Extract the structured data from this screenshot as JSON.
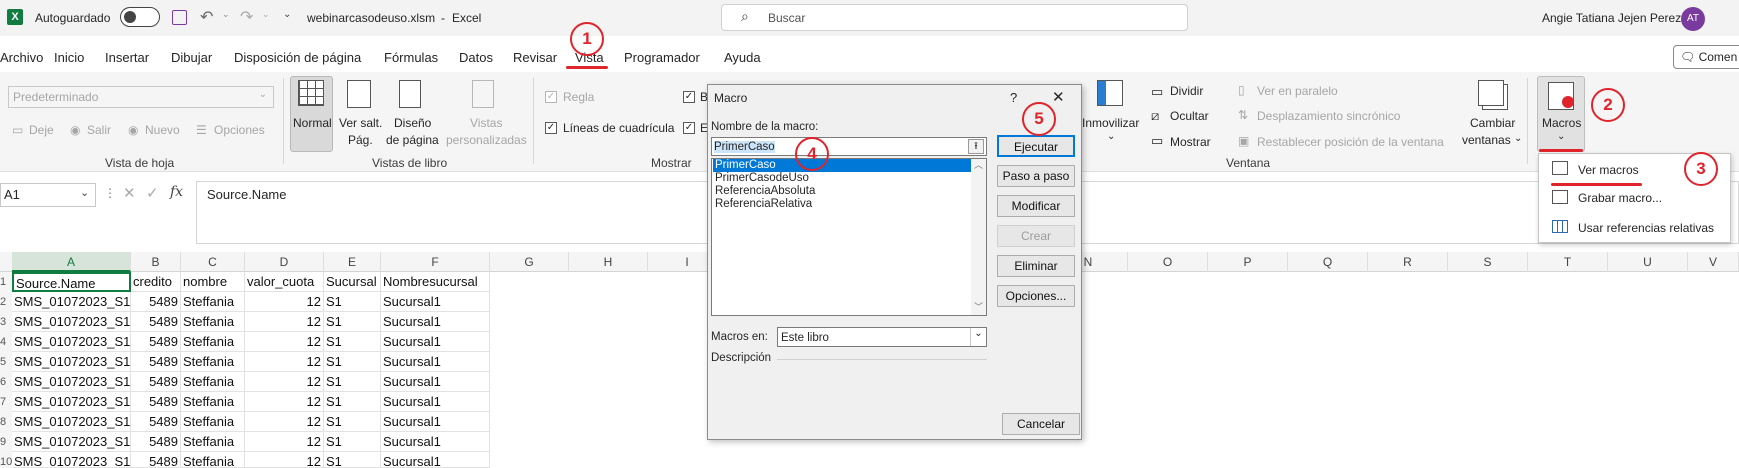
{
  "titlebar": {
    "autosave_label": "Autoguardado",
    "filename": "webinarcasodeuso.xlsm",
    "separator": "-",
    "app": "Excel",
    "search_placeholder": "Buscar",
    "user": "Angie Tatiana Jejen Perez",
    "avatar_initials": "AT"
  },
  "tabs": [
    "Archivo",
    "Inicio",
    "Insertar",
    "Dibujar",
    "Disposición de página",
    "Fórmulas",
    "Datos",
    "Revisar",
    "Vista",
    "Programador",
    "Ayuda"
  ],
  "comment_label": "Comen",
  "ribbon": {
    "sheet_views": {
      "select_value": "Predeterminado",
      "keep": "Deje",
      "exit": "Salir",
      "new": "Nuevo",
      "options": "Opciones",
      "label": "Vista de hoja"
    },
    "workbook_views": {
      "normal": "Normal",
      "page_break_1": "Ver salt.",
      "page_break_2": "Pág.",
      "layout_1": "Diseño",
      "layout_2": "de página",
      "custom_1": "Vistas",
      "custom_2": "personalizadas",
      "label": "Vistas de libro"
    },
    "show": {
      "ruler": "Regla",
      "gridlines": "Líneas de cuadrícula",
      "label": "Mostrar",
      "partial_1": "B",
      "partial_2": "E"
    },
    "window": {
      "freeze_1": "Inmovilizar",
      "split": "Dividir",
      "hide": "Ocultar",
      "show": "Mostrar",
      "side_by_side": "Ver en paralelo",
      "sync_scroll": "Desplazamiento sincrónico",
      "reset_position": "Restablecer posición de la ventana",
      "switch_1": "Cambiar",
      "switch_2": "ventanas",
      "label": "Ventana"
    },
    "macros": {
      "label": "Macros"
    }
  },
  "formula": {
    "namebox": "A1",
    "content": "Source.Name"
  },
  "grid": {
    "columns": [
      "A",
      "B",
      "C",
      "D",
      "E",
      "F",
      "G",
      "H",
      "I",
      "N",
      "O",
      "P",
      "Q",
      "R",
      "S",
      "T",
      "U",
      "V"
    ],
    "rows": [
      {
        "n": "1",
        "a": "Source.Name",
        "b": "credito",
        "c": "nombre",
        "d": "valor_cuota",
        "e": "Sucursal",
        "f": "Nombresucursal"
      },
      {
        "n": "2",
        "a": "SMS_01072023_S1",
        "b": "5489",
        "c": "Steffania",
        "d": "12",
        "e": "S1",
        "f": "Sucursal1"
      },
      {
        "n": "3",
        "a": "SMS_01072023_S1",
        "b": "5489",
        "c": "Steffania",
        "d": "12",
        "e": "S1",
        "f": "Sucursal1"
      },
      {
        "n": "4",
        "a": "SMS_01072023_S1",
        "b": "5489",
        "c": "Steffania",
        "d": "12",
        "e": "S1",
        "f": "Sucursal1"
      },
      {
        "n": "5",
        "a": "SMS_01072023_S1",
        "b": "5489",
        "c": "Steffania",
        "d": "12",
        "e": "S1",
        "f": "Sucursal1"
      },
      {
        "n": "6",
        "a": "SMS_01072023_S1",
        "b": "5489",
        "c": "Steffania",
        "d": "12",
        "e": "S1",
        "f": "Sucursal1"
      },
      {
        "n": "7",
        "a": "SMS_01072023_S1",
        "b": "5489",
        "c": "Steffania",
        "d": "12",
        "e": "S1",
        "f": "Sucursal1"
      },
      {
        "n": "8",
        "a": "SMS_01072023_S1",
        "b": "5489",
        "c": "Steffania",
        "d": "12",
        "e": "S1",
        "f": "Sucursal1"
      },
      {
        "n": "9",
        "a": "SMS_01072023_S1",
        "b": "5489",
        "c": "Steffania",
        "d": "12",
        "e": "S1",
        "f": "Sucursal1"
      },
      {
        "n": "10",
        "a": "SMS_01072023_S1",
        "b": "5489",
        "c": "Steffania",
        "d": "12",
        "e": "S1",
        "f": "Sucursal1"
      }
    ]
  },
  "dialog": {
    "title": "Macro",
    "help": "?",
    "close": "✕",
    "name_label": "Nombre de la macro:",
    "name_value": "PrimerCaso",
    "list": [
      "PrimerCaso",
      "PrimerCasodeUso",
      "ReferenciaAbsoluta",
      "ReferenciaRelativa"
    ],
    "buttons": {
      "run": "Ejecutar",
      "step": "Paso a paso",
      "edit": "Modificar",
      "create": "Crear",
      "delete": "Eliminar",
      "options": "Opciones...",
      "cancel": "Cancelar"
    },
    "macros_in_label": "Macros en:",
    "macros_in_value": "Este libro",
    "description_label": "Descripción"
  },
  "macro_menu": {
    "view": "Ver macros",
    "record": "Grabar macro...",
    "relative": "Usar referencias relativas"
  },
  "annotations": [
    "1",
    "2",
    "3",
    "4",
    "5"
  ],
  "colors": {
    "annotation_red": "#e0242b",
    "selection_blue": "#0078d7",
    "excel_green": "#107c41"
  }
}
